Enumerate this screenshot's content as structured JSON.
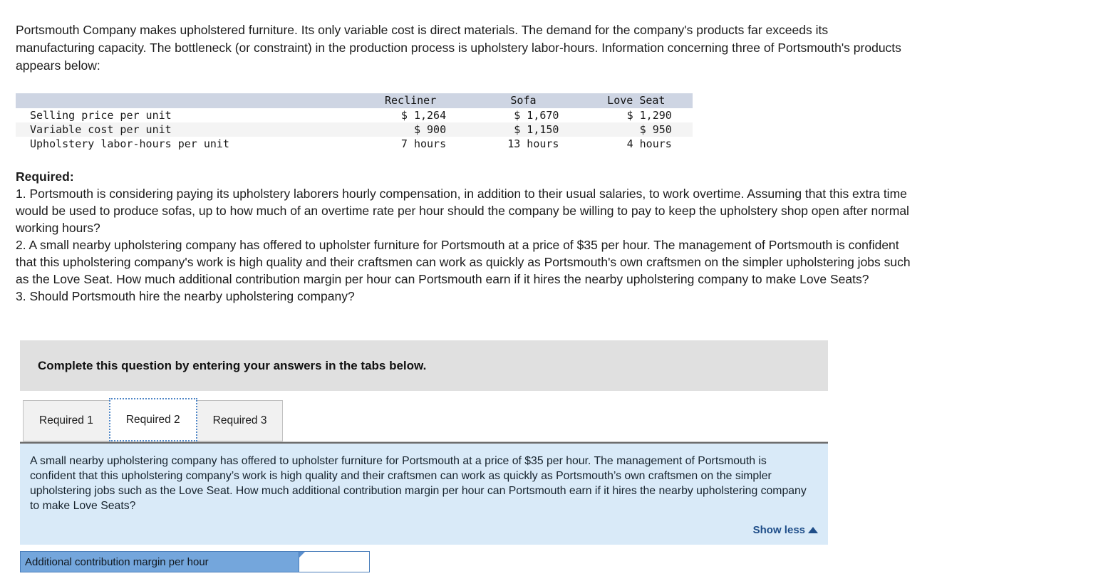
{
  "intro": {
    "paragraph": "Portsmouth Company makes upholstered furniture. Its only variable cost is direct materials. The demand for the company's products far exceeds its manufacturing capacity. The bottleneck (or constraint) in the production process is upholstery labor-hours. Information concerning three of Portsmouth's products appears below:"
  },
  "table": {
    "row_header_blank": "",
    "columns": [
      "Recliner",
      "Sofa",
      "Love Seat"
    ],
    "rows": [
      {
        "label": "Selling price per unit",
        "values": [
          "$ 1,264",
          "$ 1,670",
          "$ 1,290"
        ]
      },
      {
        "label": "Variable cost per unit",
        "values": [
          "$ 900",
          "$ 1,150",
          "$ 950"
        ]
      },
      {
        "label": "Upholstery labor-hours per unit",
        "values": [
          "7 hours",
          "13 hours",
          "4 hours"
        ]
      }
    ]
  },
  "required": {
    "title": "Required:",
    "item1": "1. Portsmouth is considering paying its upholstery laborers hourly compensation, in addition to their usual salaries, to work overtime. Assuming that this extra time would be used to produce sofas, up to how much of an overtime rate per hour should the company be willing to pay to keep the upholstery shop open after normal working hours?",
    "item2": "2.  A small nearby upholstering company has offered to upholster furniture for Portsmouth at a price of $35 per hour. The management of Portsmouth is confident that this upholstering company's work is high quality and their craftsmen can work as quickly as Portsmouth's own craftsmen on the simpler upholstering jobs such as the Love Seat. How much additional contribution margin per hour can Portsmouth earn if it hires the nearby upholstering company to make Love Seats?",
    "item3": "3. Should Portsmouth hire the nearby upholstering company?"
  },
  "instruction_banner": {
    "text": "Complete this question by entering your answers in the tabs below."
  },
  "tabs": [
    {
      "label": "Required 1",
      "active": false
    },
    {
      "label": "Required 2",
      "active": true
    },
    {
      "label": "Required 3",
      "active": false
    }
  ],
  "panel": {
    "text": "A small nearby upholstering company has offered to upholster furniture for Portsmouth at a price of $35 per hour. The management of Portsmouth is confident that this upholstering company’s work is high quality and their craftsmen can work as quickly as Portsmouth’s own craftsmen on the simpler upholstering jobs such as the Love Seat. How much additional contribution margin per hour can Portsmouth earn if it hires the nearby upholstering company to make Love Seats?",
    "show_less_label": "Show less",
    "show_less_icon": "triangle-up-icon"
  },
  "answer": {
    "label": "Additional contribution margin per hour",
    "value": "",
    "placeholder": ""
  },
  "colors": {
    "table_header_bg": "#ced5e3",
    "table_stripe_bg": "#f4f4f4",
    "banner_bg": "#e0e0e0",
    "panel_bg": "#d9eaf8",
    "tab_inactive_bg": "#f1f1f1",
    "tab_active_border": "#4f86c6",
    "answer_label_bg": "#74a6dc",
    "link_blue": "#1f4e89"
  }
}
